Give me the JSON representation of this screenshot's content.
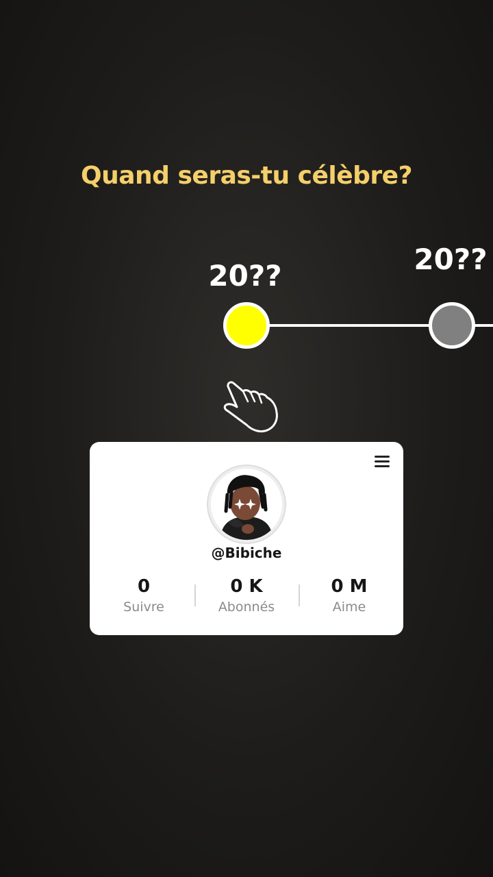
{
  "question": "Quand seras-tu célèbre?",
  "timeline": {
    "nodes": [
      {
        "label": "20??",
        "color": "#ffff00"
      },
      {
        "label": "20??",
        "color": "#808080"
      }
    ],
    "line_color": "#ffffff"
  },
  "profile": {
    "username": "@Bibiche",
    "stats": [
      {
        "value": "0",
        "label": "Suivre"
      },
      {
        "value": "0 K",
        "label": "Abonnés"
      },
      {
        "value": "0 M",
        "label": "Aime"
      }
    ]
  },
  "icons": {
    "pointer": "hand-pointer-icon",
    "menu": "hamburger-menu-icon"
  },
  "colors": {
    "question_text": "#f4cf6a",
    "background": "#1d1c1a"
  }
}
